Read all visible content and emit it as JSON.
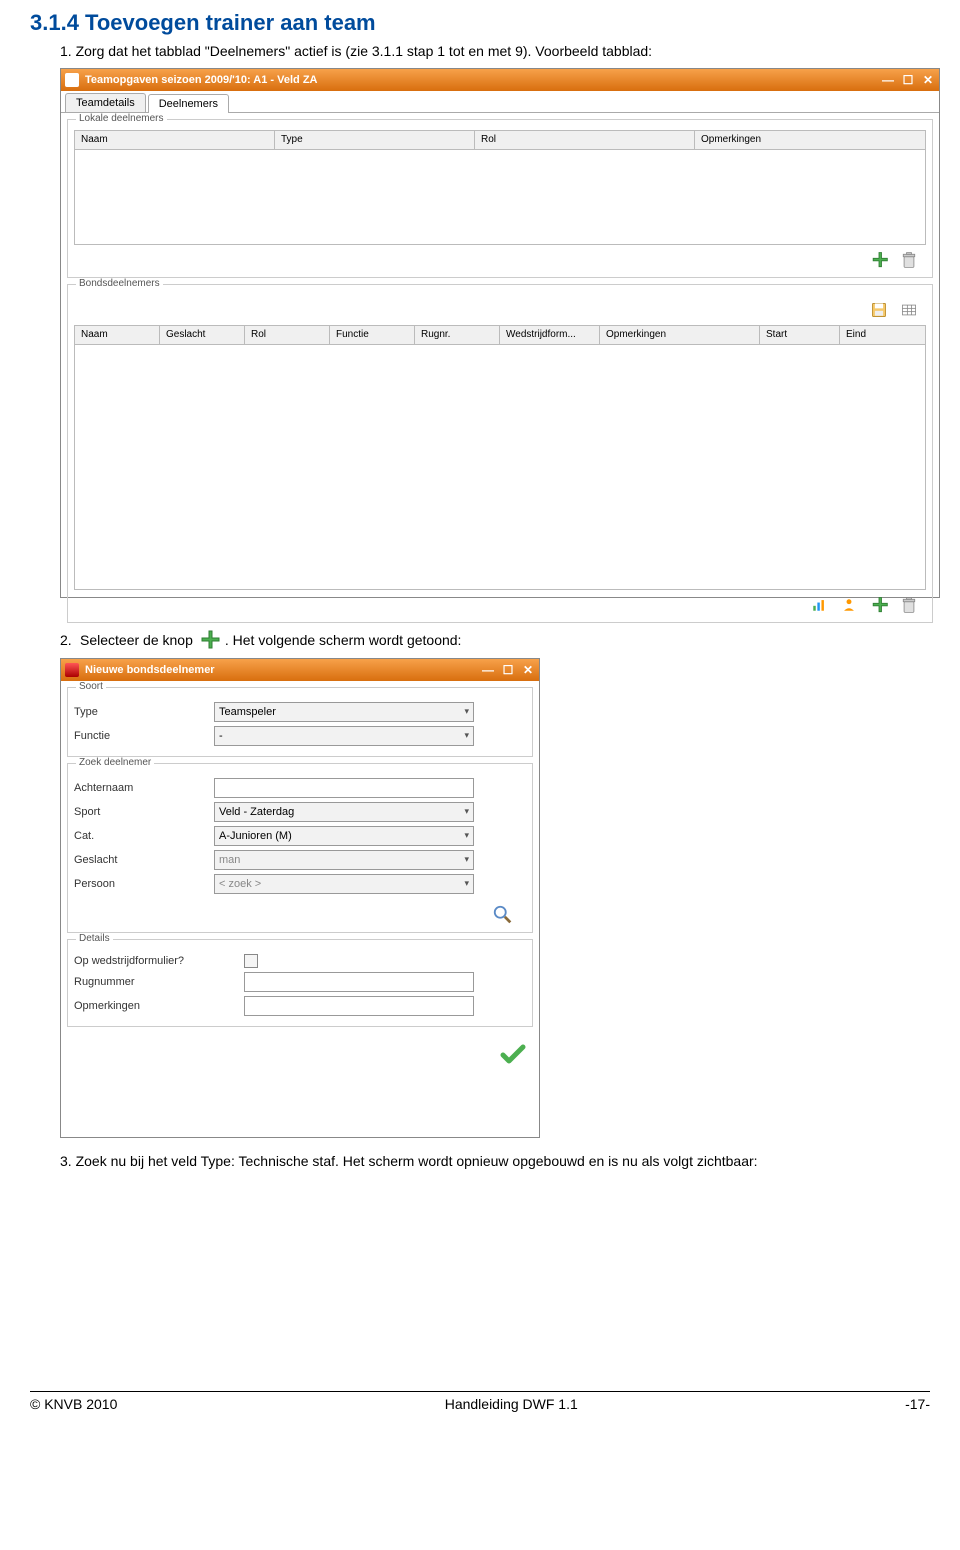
{
  "heading": "3.1.4 Toevoegen trainer aan team",
  "step1_prefix": "1.",
  "step1_text": "Zorg dat het tabblad \"Deelnemers\" actief is  (zie 3.1.1 stap 1 tot en met 9). Voorbeeld tabblad:",
  "win1": {
    "title": "Teamopgaven seizoen 2009/'10: A1 - Veld ZA",
    "tabs": [
      "Teamdetails",
      "Deelnemers"
    ],
    "active_tab": 1,
    "group1_legend": "Lokale deelnemers",
    "grid1_cols": [
      "Naam",
      "Type",
      "Rol",
      "Opmerkingen"
    ],
    "group2_legend": "Bondsdeelnemers",
    "grid2_cols": [
      "Naam",
      "Geslacht",
      "Rol",
      "Functie",
      "Rugnr.",
      "Wedstrijdform...",
      "Opmerkingen",
      "Start",
      "Eind"
    ]
  },
  "step2_prefix": "2.",
  "step2_text_a": "Selecteer de knop",
  "step2_text_b": ". Het volgende scherm wordt getoond:",
  "win2": {
    "title": "Nieuwe bondsdeelnemer",
    "group_soort": "Soort",
    "type_lbl": "Type",
    "type_val": "Teamspeler",
    "functie_lbl": "Functie",
    "functie_val": "-",
    "group_zoek": "Zoek deelnemer",
    "achternaam_lbl": "Achternaam",
    "sport_lbl": "Sport",
    "sport_val": "Veld - Zaterdag",
    "cat_lbl": "Cat.",
    "cat_val": "A-Junioren (M)",
    "geslacht_lbl": "Geslacht",
    "geslacht_val": "man",
    "persoon_lbl": "Persoon",
    "persoon_placeholder": "< zoek >",
    "group_details": "Details",
    "opwed_lbl": "Op wedstrijdformulier?",
    "rugnummer_lbl": "Rugnummer",
    "opmerkingen_lbl": "Opmerkingen"
  },
  "step3_prefix": "3.",
  "step3_text": "Zoek nu bij het veld Type: Technische staf. Het scherm wordt opnieuw opgebouwd en is nu als volgt zichtbaar:",
  "footer_left": "© KNVB 2010",
  "footer_center": "Handleiding DWF 1.1",
  "footer_right": "-17-"
}
